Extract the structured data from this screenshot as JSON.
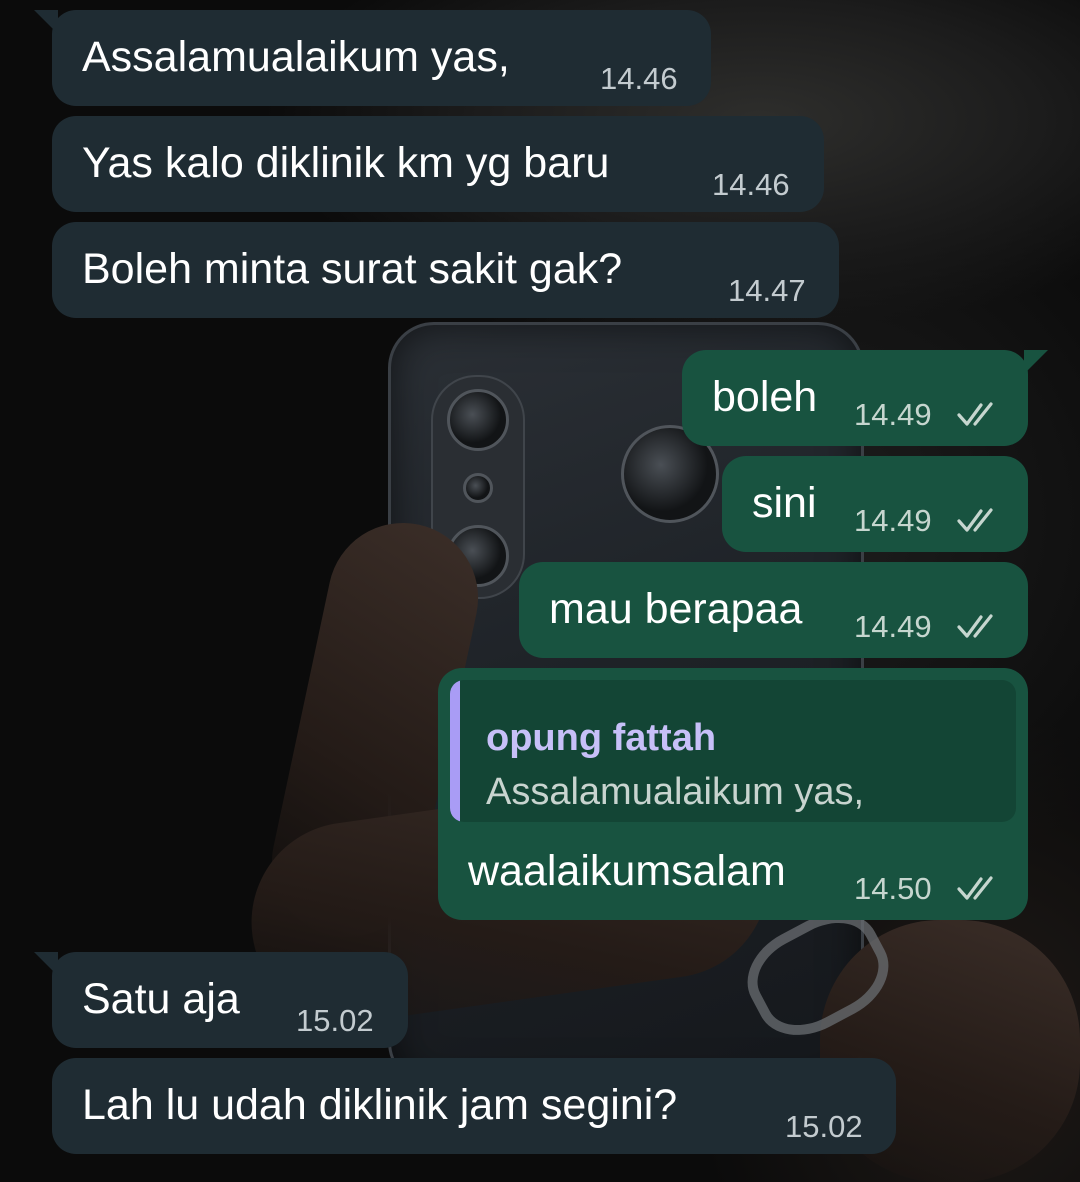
{
  "wallpaper": {
    "background_color": "#0b0b0b",
    "description_icon": "photo-wallpaper"
  },
  "colors": {
    "incoming_bubble": "#1f2c33",
    "outgoing_bubble": "#185340",
    "quote_background": "#134535",
    "quote_accent": "#a99cf5",
    "read_ticks": "#c6d6cf"
  },
  "messages": [
    {
      "direction": "incoming",
      "text": "Assalamualaikum yas,",
      "time": "14.46"
    },
    {
      "direction": "incoming",
      "text": "Yas kalo diklinik km yg baru",
      "time": "14.46"
    },
    {
      "direction": "incoming",
      "text": "Boleh minta surat sakit gak?",
      "time": "14.47"
    },
    {
      "direction": "outgoing",
      "text": "boleh",
      "time": "14.49",
      "status_icon": "double-check-icon"
    },
    {
      "direction": "outgoing",
      "text": "sini",
      "time": "14.49",
      "status_icon": "double-check-icon"
    },
    {
      "direction": "outgoing",
      "text": "mau berapaa",
      "time": "14.49",
      "status_icon": "double-check-icon"
    },
    {
      "direction": "outgoing",
      "text": "waalaikumsalam",
      "time": "14.50",
      "status_icon": "double-check-icon",
      "reply_to": {
        "name": "opung fattah",
        "text": "Assalamualaikum yas,"
      }
    },
    {
      "direction": "incoming",
      "text": "Satu aja",
      "time": "15.02"
    },
    {
      "direction": "incoming",
      "text": "Lah lu udah diklinik jam segini?",
      "time": "15.02"
    }
  ]
}
